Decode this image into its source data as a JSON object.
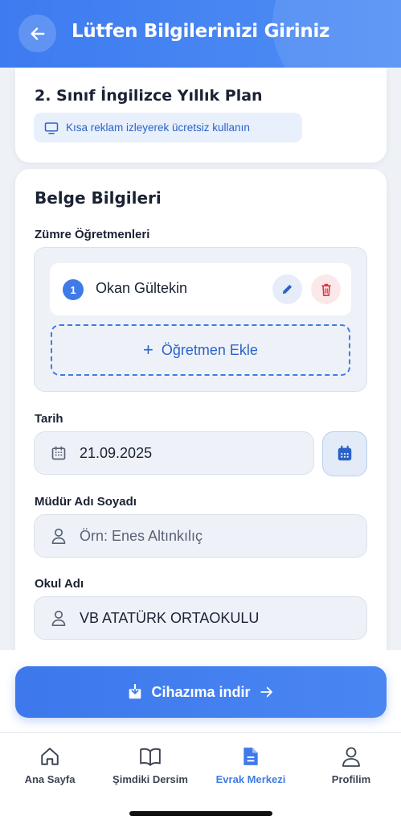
{
  "header": {
    "title": "Lütfen Bilgilerinizi Giriniz"
  },
  "document": {
    "title": "2. Sınıf İngilizce Yıllık Plan",
    "ad_notice": "Kısa reklam izleyerek ücretsiz kullanın"
  },
  "form": {
    "section_title": "Belge Bilgileri",
    "teachers_label": "Zümre Öğretmenleri",
    "teachers": [
      {
        "number": "1",
        "name": "Okan Gültekin"
      }
    ],
    "add_teacher_label": "Öğretmen Ekle",
    "date_label": "Tarih",
    "date_value": "21.09.2025",
    "principal_label": "Müdür Adı Soyadı",
    "principal_placeholder": "Örn: Enes Altınkılıç",
    "school_label": "Okul Adı",
    "school_value": "VB ATATÜRK ORTAOKULU"
  },
  "download": {
    "label": "Cihazıma indir"
  },
  "tabs": [
    {
      "label": "Ana Sayfa",
      "icon": "home-icon",
      "active": false
    },
    {
      "label": "Şimdiki Dersim",
      "icon": "book-icon",
      "active": false
    },
    {
      "label": "Evrak Merkezi",
      "icon": "document-icon",
      "active": true
    },
    {
      "label": "Profilim",
      "icon": "user-icon",
      "active": false
    }
  ],
  "colors": {
    "primary": "#3f7ae8",
    "danger": "#e0353f",
    "background": "#eef1f6"
  }
}
